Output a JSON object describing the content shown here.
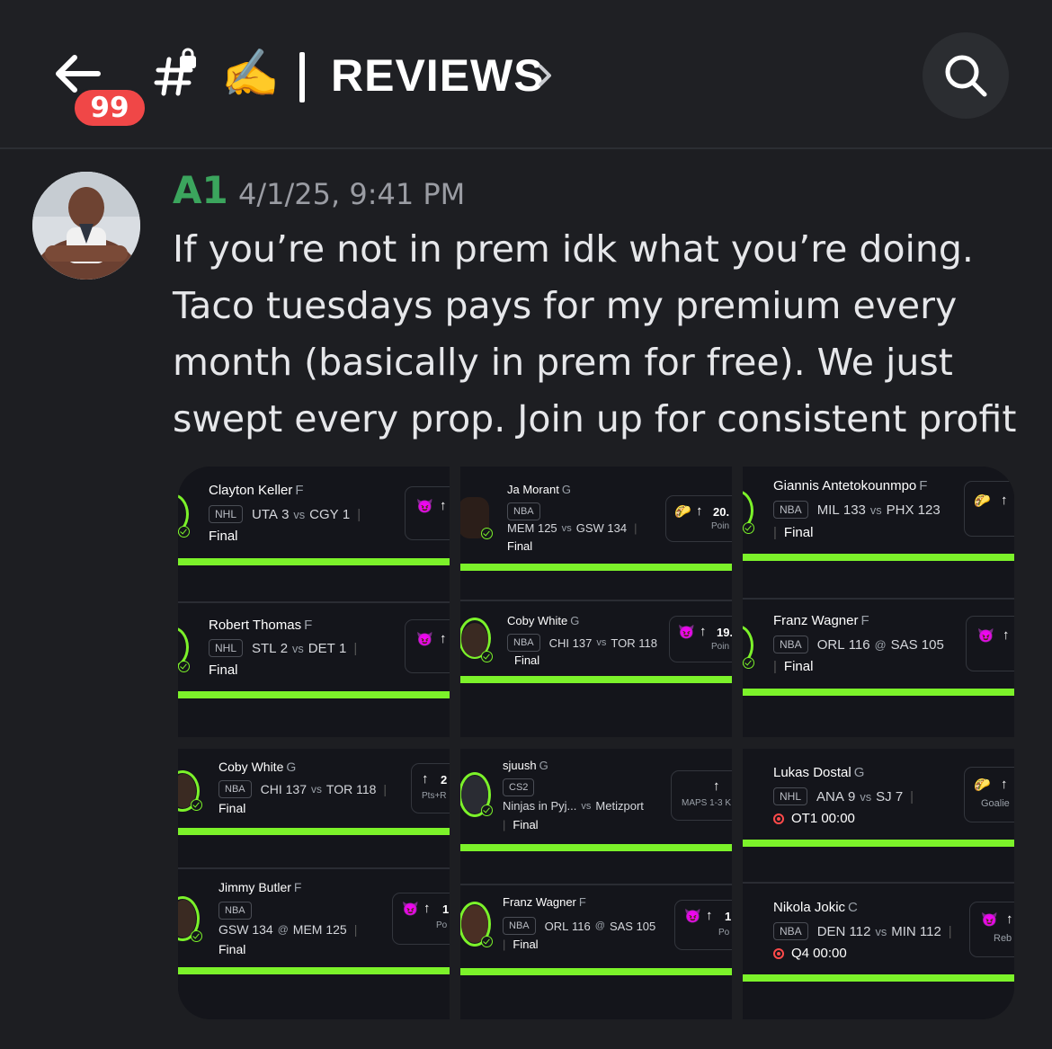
{
  "header": {
    "back_label": "Back",
    "unread_count": "99",
    "channel_emoji": "✍️",
    "channel_name": "REVIEWS",
    "icons": [
      "arrow-left-icon",
      "hash-lock-icon",
      "chevron-right-icon",
      "search-icon"
    ]
  },
  "message": {
    "author": "A1",
    "timestamp": "4/1/25, 9:41 PM",
    "text": "If you’re not in prem idk what you’re doing. Taco tuesdays pays for my premium every month (basically in prem for free). We just swept every prop. Join up for consistent profit",
    "author_color": "#3ba55d"
  },
  "screenshots": {
    "col1_top": {
      "cards": [
        {
          "player": "Clayton Keller",
          "pos": "F",
          "league": "NHL",
          "home": "UTA",
          "home_score": "3",
          "vs": "vs",
          "away": "CGY",
          "away_score": "1",
          "status": "Final",
          "arrow": "↑",
          "icon": "devil-emoji"
        },
        {
          "player": "Robert Thomas",
          "pos": "F",
          "league": "NHL",
          "home": "STL",
          "home_score": "2",
          "vs": "vs",
          "away": "DET",
          "away_score": "1",
          "status": "Final",
          "arrow": "↑",
          "icon": "devil-emoji"
        }
      ]
    },
    "col2_top": {
      "cards": [
        {
          "player": "Ja Morant",
          "pos": "G",
          "league": "NBA",
          "home": "MEM",
          "home_score": "125",
          "vs": "vs",
          "away": "GSW",
          "away_score": "134",
          "status": "Final",
          "arrow": "↑",
          "value": "20.",
          "label": "Poin",
          "icon": "taco-emoji"
        },
        {
          "player": "Coby White",
          "pos": "G",
          "league": "NBA",
          "home": "CHI",
          "home_score": "137",
          "vs": "vs",
          "away": "TOR",
          "away_score": "118",
          "status": "Final",
          "arrow": "↑",
          "value": "19.",
          "label": "Poin",
          "icon": "devil-emoji"
        }
      ]
    },
    "col3_top": {
      "cards": [
        {
          "player": "Giannis Antetokounmpo",
          "pos": "F",
          "league": "NBA",
          "home": "MIL",
          "home_score": "133",
          "vs": "vs",
          "away": "PHX",
          "away_score": "123",
          "status": "Final",
          "arrow": "↑",
          "icon": "taco-emoji"
        },
        {
          "player": "Franz Wagner",
          "pos": "F",
          "league": "NBA",
          "home": "ORL",
          "home_score": "116",
          "vs": "@",
          "away": "SAS",
          "away_score": "105",
          "status": "Final",
          "arrow": "↑",
          "icon": "devil-emoji"
        }
      ]
    },
    "col1_bottom": {
      "cards": [
        {
          "player": "Coby White",
          "pos": "G",
          "league": "NBA",
          "home": "CHI",
          "home_score": "137",
          "vs": "vs",
          "away": "TOR",
          "away_score": "118",
          "status": "Final",
          "arrow": "↑",
          "value": "2",
          "label": "Pts+R"
        },
        {
          "player": "Jimmy Butler",
          "pos": "F",
          "league": "NBA",
          "home": "GSW",
          "home_score": "134",
          "vs": "@",
          "away": "MEM",
          "away_score": "125",
          "status": "Final",
          "arrow": "↑",
          "value": "1",
          "label": "Po",
          "icon": "devil-emoji"
        }
      ]
    },
    "col2_bottom": {
      "cards": [
        {
          "player": "sjuush",
          "pos": "G",
          "league": "CS2",
          "home": "Ninjas in Pyj...",
          "home_score": "",
          "vs": "vs",
          "away": "Metizport",
          "away_score": "",
          "status": "Final",
          "arrow": "↑",
          "label": "MAPS 1-3 K"
        },
        {
          "player": "Franz Wagner",
          "pos": "F",
          "league": "NBA",
          "home": "ORL",
          "home_score": "116",
          "vs": "@",
          "away": "SAS",
          "away_score": "105",
          "status": "Final",
          "arrow": "↑",
          "value": "1",
          "label": "Po",
          "icon": "devil-emoji"
        }
      ]
    },
    "col3_bottom": {
      "cards": [
        {
          "player": "Lukas Dostal",
          "pos": "G",
          "league": "NHL",
          "home": "ANA",
          "home_score": "9",
          "vs": "vs",
          "away": "SJ",
          "away_score": "7",
          "status": "OT1 00:00",
          "arrow": "↑",
          "label": "Goalie",
          "icon": "taco-emoji",
          "live": true
        },
        {
          "player": "Nikola Jokic",
          "pos": "C",
          "league": "NBA",
          "home": "DEN",
          "home_score": "112",
          "vs": "vs",
          "away": "MIN",
          "away_score": "112",
          "status": "Q4 00:00",
          "arrow": "↑",
          "label": "Reb",
          "icon": "devil-emoji",
          "live": true
        }
      ]
    }
  },
  "colors": {
    "accent_green": "#7cf22a",
    "badge_red": "#f04747",
    "background": "#1d1e22",
    "card_bg": "#14151b",
    "live_red": "#ff4a4a"
  }
}
